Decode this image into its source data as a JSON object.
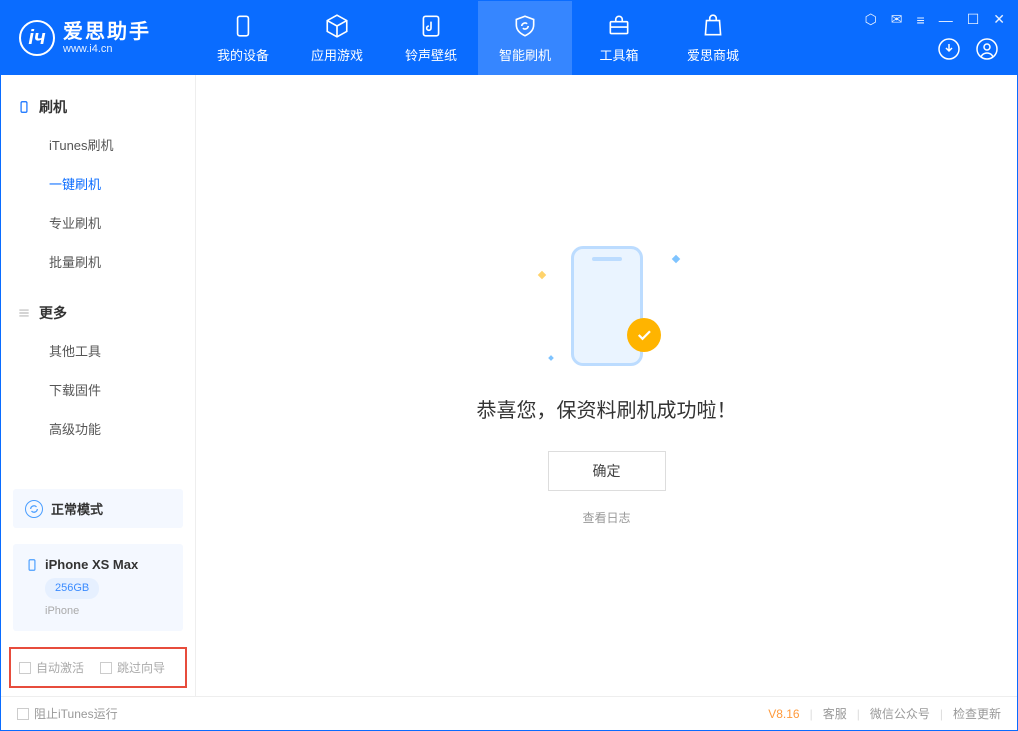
{
  "app": {
    "name": "爱思助手",
    "domain": "www.i4.cn"
  },
  "nav": {
    "tabs": [
      {
        "label": "我的设备"
      },
      {
        "label": "应用游戏"
      },
      {
        "label": "铃声壁纸"
      },
      {
        "label": "智能刷机"
      },
      {
        "label": "工具箱"
      },
      {
        "label": "爱思商城"
      }
    ]
  },
  "sidebar": {
    "section1": {
      "title": "刷机",
      "items": [
        "iTunes刷机",
        "一键刷机",
        "专业刷机",
        "批量刷机"
      ]
    },
    "section2": {
      "title": "更多",
      "items": [
        "其他工具",
        "下载固件",
        "高级功能"
      ]
    },
    "mode": "正常模式",
    "device": {
      "name": "iPhone XS Max",
      "storage": "256GB",
      "type": "iPhone"
    },
    "checks": {
      "auto_activate": "自动激活",
      "skip_wizard": "跳过向导"
    }
  },
  "main": {
    "success_text": "恭喜您，保资料刷机成功啦！",
    "ok_button": "确定",
    "view_log": "查看日志"
  },
  "statusbar": {
    "block_itunes": "阻止iTunes运行",
    "version": "V8.16",
    "links": [
      "客服",
      "微信公众号",
      "检查更新"
    ]
  }
}
